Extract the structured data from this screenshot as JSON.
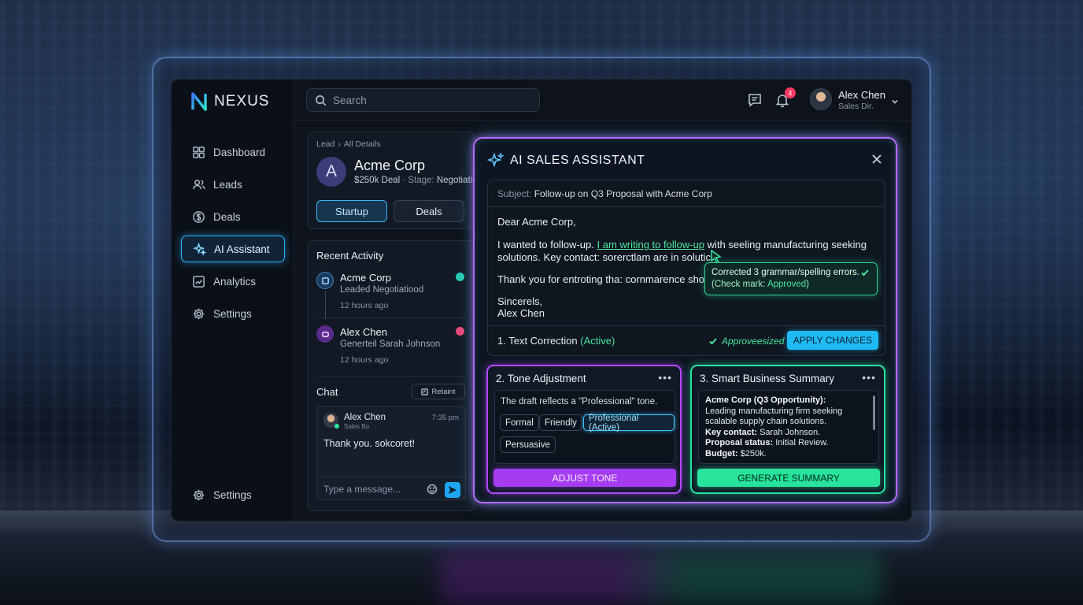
{
  "app": {
    "name": "NEXUS"
  },
  "search": {
    "placeholder": "Search"
  },
  "notifications": {
    "count": "4"
  },
  "user": {
    "name": "Alex Chen",
    "role": "Sales Dir."
  },
  "sidebar": {
    "items": [
      {
        "label": "Dashboard",
        "icon": "dashboard-icon"
      },
      {
        "label": "Leads",
        "icon": "users-icon"
      },
      {
        "label": "Deals",
        "icon": "dollar-icon"
      },
      {
        "label": "AI Assistant",
        "icon": "sparkle-icon",
        "active": true
      },
      {
        "label": "Analytics",
        "icon": "chart-icon"
      },
      {
        "label": "Settings",
        "icon": "gear-icon"
      }
    ],
    "bottom": {
      "label": "Settings",
      "icon": "gear-icon"
    }
  },
  "breadcrumb": {
    "root": "Lead",
    "current": "All Details"
  },
  "company": {
    "initial": "A",
    "name": "Acme Corp",
    "deal": "$250k Deal",
    "stage_label": "Stage:",
    "stage": "Negotiatio"
  },
  "company_tabs": {
    "startup": "Startup",
    "deals": "Deals"
  },
  "recent_activity": {
    "title": "Recent Activity",
    "items": [
      {
        "name": "Acme Corp",
        "desc": "Leaded Negotiatiood",
        "time": "12 hours ago"
      },
      {
        "name": "Alex Chen",
        "desc": "Generteil Sarah Johnson",
        "time": "12 hours ago"
      }
    ]
  },
  "chat": {
    "title": "Chat",
    "retain_label": "Retaint",
    "sender": "Alex Chen",
    "sender_role": "Sales Bo",
    "time": "7:35 pm",
    "message": "Thank you. sokcoret!",
    "input_placeholder": "Type a message..."
  },
  "ai": {
    "title": "AI SALES ASSISTANT",
    "subject_label": "Subject:",
    "subject": "Follow-up on Q3 Proposal with Acme Corp",
    "greeting": "Dear Acme Corp,",
    "line1_pre": "I wanted to follow-up.",
    "line1_hl": "I am writing to follow-up",
    "line1_post": "with seeling manufacturing seeking",
    "line2": "solutions. Key contact: sorerctlam are in solutic",
    "line3": "Thank you for entroting tha: cornmarence shoc:ton",
    "closing": "Sincerels,",
    "signature": "Alex Chen",
    "tooltip_line1": "Corrected 3 grammar/spelling errors.",
    "tooltip_line2_pre": "(Check mark:",
    "tooltip_line2_val": "Approved",
    "tooltip_line2_post": ")",
    "correction_label": "1. Text Correction",
    "correction_status": "(Active)",
    "approved_label": "Approveesized",
    "apply_button": "APPLY CHANGES",
    "tone": {
      "title": "2. Tone Adjustment",
      "desc": "The draft reflects a \"Professional\" tone.",
      "chips": [
        "Formal",
        "Friendly",
        "Professional (Active)",
        "Persuasive"
      ],
      "button": "ADJUST TONE"
    },
    "summary": {
      "title": "3. Smart Business Summary",
      "heading": "Acme Corp (Q3 Opportunity):",
      "body": "Leading manufacturing firm seeking scalable supply chain solutions.",
      "contact_label": "Key contact:",
      "contact": "Sarah Johnson.",
      "status_label": "Proposal status:",
      "status": "Initial Review.",
      "budget_label": "Budget:",
      "budget": "$250k.",
      "button": "GENERATE SUMMARY"
    }
  },
  "colors": {
    "accent_blue": "#2fb6ff",
    "accent_purple": "#b14cff",
    "accent_green": "#27e39b",
    "badge_red": "#ff3b63"
  }
}
